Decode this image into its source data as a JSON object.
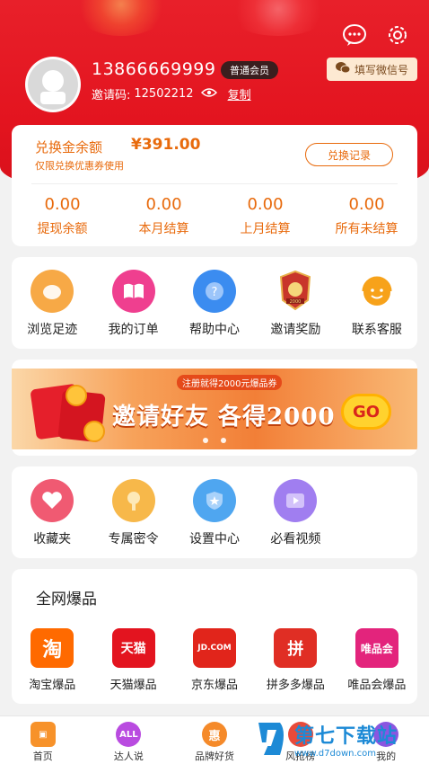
{
  "header": {
    "phone": "13866669999",
    "member_level": "普通会员",
    "invite_label": "邀请码:",
    "invite_code": "12502212",
    "copy_label": "复制",
    "wechat_button": "填写微信号"
  },
  "balance": {
    "title": "兑换金余额",
    "amount": "¥391.00",
    "note": "仅限兑换优惠券使用",
    "record_button": "兑换记录",
    "stats": [
      {
        "value": "0.00",
        "label": "提现余额"
      },
      {
        "value": "0.00",
        "label": "本月结算"
      },
      {
        "value": "0.00",
        "label": "上月结算"
      },
      {
        "value": "0.00",
        "label": "所有未结算"
      }
    ]
  },
  "menu1": [
    {
      "label": "浏览足迹",
      "icon": "footprint-icon",
      "color": "#f7a946"
    },
    {
      "label": "我的订单",
      "icon": "book-icon",
      "color": "#ef3f8f"
    },
    {
      "label": "帮助中心",
      "icon": "help-icon",
      "color": "#3b8cf0"
    },
    {
      "label": "邀请奖励",
      "icon": "medal-icon",
      "color": "#c8362b"
    },
    {
      "label": "联系客服",
      "icon": "headset-icon",
      "color": "#f7a21a"
    }
  ],
  "banner": {
    "headline": "邀请好友 各得2000",
    "sub": "注册就得2000元爆品券",
    "go": "GO",
    "medal_text": "2000"
  },
  "menu2": [
    {
      "label": "收藏夹",
      "icon": "heart-icon",
      "color": "#f05a72"
    },
    {
      "label": "专属密令",
      "icon": "key-icon",
      "color": "#f7b84a"
    },
    {
      "label": "设置中心",
      "icon": "shield-icon",
      "color": "#4fa6f0"
    },
    {
      "label": "必看视频",
      "icon": "video-icon",
      "color": "#a07ef0"
    }
  ],
  "products": {
    "title": "全网爆品",
    "items": [
      {
        "label": "淘宝爆品",
        "logo_text": "淘",
        "color": "#ff6a00"
      },
      {
        "label": "天猫爆品",
        "logo_text": "天猫",
        "color": "#e3141f"
      },
      {
        "label": "京东爆品",
        "logo_text": "JD.COM",
        "color": "#e1251b"
      },
      {
        "label": "拼多多爆品",
        "logo_text": "拼",
        "color": "#e02e24"
      },
      {
        "label": "唯品会爆品",
        "logo_text": "唯品会",
        "color": "#e3247c"
      }
    ]
  },
  "tabs": [
    {
      "label": "首页",
      "icon": "home-icon",
      "color": "#f7922a",
      "glyph": "▣"
    },
    {
      "label": "达人说",
      "icon": "talent-icon",
      "color": "#b94be0",
      "glyph": "ALL"
    },
    {
      "label": "品牌好货",
      "icon": "brand-icon",
      "color": "#f58a2a",
      "glyph": "惠"
    },
    {
      "label": "风抢榜",
      "icon": "rank-icon",
      "color": "#e84a3a",
      "glyph": ""
    },
    {
      "label": "我的",
      "icon": "user-icon",
      "color": "#8a56e0",
      "glyph": ""
    }
  ],
  "watermark": {
    "text": "第七下载站",
    "url": "www.d7down.com"
  }
}
